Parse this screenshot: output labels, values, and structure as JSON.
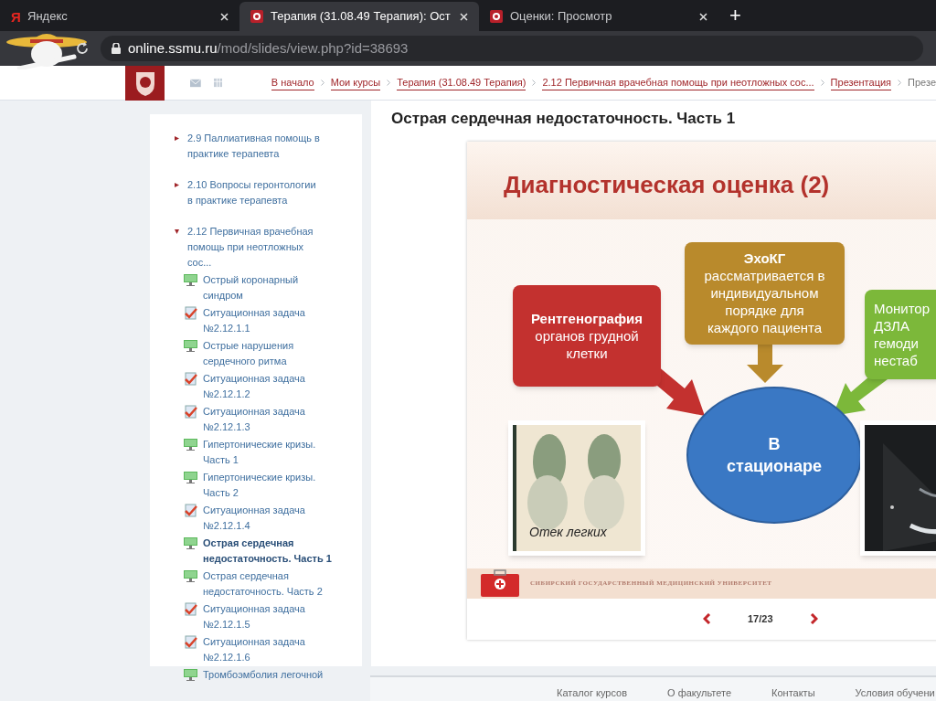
{
  "browser": {
    "tabs": [
      {
        "title": "Яндекс",
        "kind": "yandex",
        "favicon": "Я",
        "selected": false
      },
      {
        "title": "Терапия (31.08.49 Терапия): Ост",
        "kind": "site",
        "selected": true
      },
      {
        "title": "Оценки: Просмотр",
        "kind": "site",
        "selected": false
      }
    ],
    "new_tab": "+",
    "url": {
      "domain": "online.ssmu.ru",
      "path": "/mod/slides/view.php?id=38693"
    }
  },
  "breadcrumb": [
    "В начало",
    "Мои курсы",
    "Терапия (31.08.49 Терапия)",
    "2.12 Первичная врачебная помощь при неотложных сос...",
    "Презентация",
    "Презе"
  ],
  "sidebar": {
    "items": [
      {
        "label": "2.9 Паллиативная помощь в практике терапевта",
        "expanded": false
      },
      {
        "label": "2.10 Вопросы геронтологии в практике терапевта",
        "expanded": false
      },
      {
        "label": "2.12 Первичная врачебная помощь при неотложных сос...",
        "expanded": true,
        "children": [
          {
            "label": "Острый коронарный синдром",
            "kind": "slides",
            "selected": false
          },
          {
            "label": "Ситуационная задача №2.12.1.1",
            "kind": "quiz",
            "selected": false
          },
          {
            "label": "Острые нарушения сердечного ритма",
            "kind": "slides",
            "selected": false
          },
          {
            "label": "Ситуационная задача №2.12.1.2",
            "kind": "quiz",
            "selected": false
          },
          {
            "label": "Ситуационная задача №2.12.1.3",
            "kind": "quiz",
            "selected": false
          },
          {
            "label": "Гипертонические кризы. Часть 1",
            "kind": "slides",
            "selected": false
          },
          {
            "label": "Гипертонические кризы. Часть 2",
            "kind": "slides",
            "selected": false
          },
          {
            "label": "Ситуационная задача №2.12.1.4",
            "kind": "quiz",
            "selected": false
          },
          {
            "label": "Острая сердечная недостаточность. Часть 1",
            "kind": "slides",
            "selected": true
          },
          {
            "label": "Острая сердечная недостаточность. Часть 2",
            "kind": "slides",
            "selected": false
          },
          {
            "label": "Ситуационная задача №2.12.1.5",
            "kind": "quiz",
            "selected": false
          },
          {
            "label": "Ситуационная задача №2.12.1.6",
            "kind": "quiz",
            "selected": false
          },
          {
            "label": "Тромбоэмболия легочной",
            "kind": "slides",
            "selected": false
          }
        ]
      }
    ]
  },
  "page_title": "Острая сердечная недостаточность. Часть 1",
  "slide": {
    "title": "Диагностическая оценка (2)",
    "boxes": [
      {
        "heading": "Рентгенография",
        "lines": [
          "органов грудной",
          "клетки"
        ],
        "color": "#c3312f"
      },
      {
        "heading": "ЭхоКГ",
        "lines": [
          "рассматривается в",
          "индивидуальном",
          "порядке для",
          "каждого пациента"
        ],
        "color": "#b98a2c"
      },
      {
        "lines": [
          "Монитор",
          "ДЗЛА",
          "гемоди",
          "нестаб"
        ],
        "color": "#7cb83a"
      }
    ],
    "center": "В стационаре",
    "caption": "Отек легких",
    "footer": "СИБИРСКИЙ ГОСУДАРСТВЕННЫЙ МЕДИЦИНСКИЙ УНИВЕРСИТЕТ"
  },
  "pager": {
    "counter": "17/23"
  },
  "footer_links": [
    "Каталог курсов",
    "О факультете",
    "Контакты",
    "Условия обучени"
  ]
}
